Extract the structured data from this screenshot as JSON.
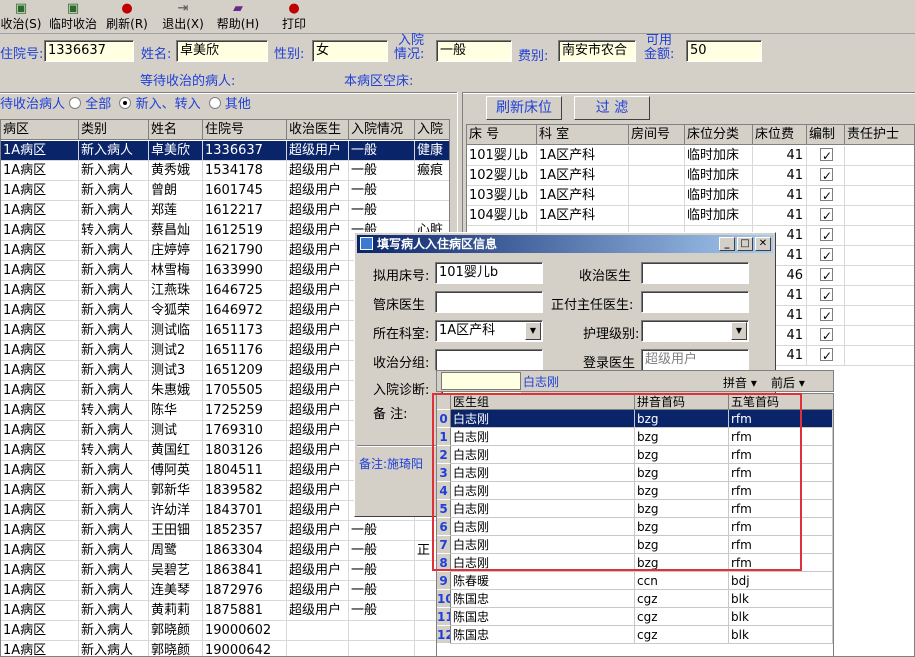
{
  "toolbar": {
    "items": [
      {
        "label": "收治(S)",
        "icon": "admit-icon"
      },
      {
        "label": "临时收治",
        "icon": "temp-admit-icon"
      },
      {
        "label": "刷新(R)",
        "icon": "refresh-icon"
      },
      {
        "label": "退出(X)",
        "icon": "exit-icon"
      },
      {
        "label": "帮助(H)",
        "icon": "help-book-icon"
      },
      {
        "label": "打印",
        "icon": "print-icon"
      }
    ]
  },
  "info": {
    "admission_no_label": "住院号:",
    "admission_no": "1336637",
    "name_label": "姓名:",
    "name": "卓美欣",
    "gender_label": "性别:",
    "gender": "女",
    "admit_status_label_1": "入院",
    "admit_status_label_2": "情况:",
    "admit_status": "一般",
    "fee_label": "费别:",
    "fee": "南安市农合",
    "available_label_1": "可用",
    "available_label_2": "金额:",
    "available": "50",
    "waiting_caption": "等待收治的病人:",
    "empty_beds_caption": "本病区空床:"
  },
  "filter": {
    "label": "待收治病人",
    "options": [
      "全部",
      "新入、转入",
      "其他"
    ],
    "selected": 1
  },
  "patients": {
    "columns": [
      "病区",
      "类别",
      "姓名",
      "住院号",
      "收治医生",
      "入院情况",
      "入院"
    ],
    "rows": [
      [
        "1A病区",
        "新入病人",
        "卓美欣",
        "1336637",
        "超级用户",
        "一般",
        "健康"
      ],
      [
        "1A病区",
        "新入病人",
        "黄秀娥",
        "1534178",
        "超级用户",
        "一般",
        "瘢痕"
      ],
      [
        "1A病区",
        "新入病人",
        "曾朗",
        "1601745",
        "超级用户",
        "一般",
        ""
      ],
      [
        "1A病区",
        "新入病人",
        "郑莲",
        "1612217",
        "超级用户",
        "一般",
        ""
      ],
      [
        "1A病区",
        "转入病人",
        "蔡昌灿",
        "1612519",
        "超级用户",
        "一般",
        "心脏"
      ],
      [
        "1A病区",
        "新入病人",
        "庄婷婷",
        "1621790",
        "超级用户",
        "",
        ""
      ],
      [
        "1A病区",
        "新入病人",
        "林雪梅",
        "1633990",
        "超级用户",
        "",
        ""
      ],
      [
        "1A病区",
        "新入病人",
        "江燕珠",
        "1646725",
        "超级用户",
        "",
        ""
      ],
      [
        "1A病区",
        "新入病人",
        "令狐荣",
        "1646972",
        "超级用户",
        "",
        ""
      ],
      [
        "1A病区",
        "新入病人",
        "测试临",
        "1651173",
        "超级用户",
        "",
        ""
      ],
      [
        "1A病区",
        "新入病人",
        "测试2",
        "1651176",
        "超级用户",
        "",
        ""
      ],
      [
        "1A病区",
        "新入病人",
        "测试3",
        "1651209",
        "超级用户",
        "",
        ""
      ],
      [
        "1A病区",
        "新入病人",
        "朱惠娥",
        "1705505",
        "超级用户",
        "",
        ""
      ],
      [
        "1A病区",
        "转入病人",
        "陈华",
        "1725259",
        "超级用户",
        "",
        ""
      ],
      [
        "1A病区",
        "新入病人",
        "测试",
        "1769310",
        "超级用户",
        "",
        ""
      ],
      [
        "1A病区",
        "转入病人",
        "黄国红",
        "1803126",
        "超级用户",
        "",
        ""
      ],
      [
        "1A病区",
        "新入病人",
        "傅阿英",
        "1804511",
        "超级用户",
        "",
        ""
      ],
      [
        "1A病区",
        "新入病人",
        "郭新华",
        "1839582",
        "超级用户",
        "",
        ""
      ],
      [
        "1A病区",
        "新入病人",
        "许幼洋",
        "1843701",
        "超级用户",
        "",
        ""
      ],
      [
        "1A病区",
        "新入病人",
        "王田钿",
        "1852357",
        "超级用户",
        "一般",
        ""
      ],
      [
        "1A病区",
        "新入病人",
        "周鹭",
        "1863304",
        "超级用户",
        "一般",
        "正"
      ],
      [
        "1A病区",
        "新入病人",
        "吴碧艺",
        "1863841",
        "超级用户",
        "一般",
        ""
      ],
      [
        "1A病区",
        "新入病人",
        "连美琴",
        "1872976",
        "超级用户",
        "一般",
        ""
      ],
      [
        "1A病区",
        "新入病人",
        "黄莉莉",
        "1875881",
        "超级用户",
        "一般",
        ""
      ],
      [
        "1A病区",
        "新入病人",
        "郭晓颜",
        "19000602",
        "",
        "",
        ""
      ],
      [
        "1A病区",
        "新入病人",
        "郭晓颜",
        "19000642",
        "",
        "",
        ""
      ]
    ]
  },
  "beds": {
    "refresh_label": "刷新床位",
    "filter_label": "过  滤",
    "columns": [
      "床  号",
      "科  室",
      "房间号",
      "床位分类",
      "床位费",
      "编制",
      "责任护士"
    ],
    "rows": [
      [
        "101婴儿b",
        "1A区产科",
        "",
        "临时加床",
        "41",
        true,
        ""
      ],
      [
        "102婴儿b",
        "1A区产科",
        "",
        "临时加床",
        "41",
        true,
        ""
      ],
      [
        "103婴儿b",
        "1A区产科",
        "",
        "临时加床",
        "41",
        true,
        ""
      ],
      [
        "104婴儿b",
        "1A区产科",
        "",
        "临时加床",
        "41",
        true,
        ""
      ],
      [
        "",
        "",
        "",
        "",
        "41",
        true,
        ""
      ],
      [
        "",
        "",
        "",
        "",
        "41",
        true,
        ""
      ],
      [
        "",
        "",
        "",
        "",
        "46",
        true,
        ""
      ],
      [
        "",
        "",
        "",
        "",
        "41",
        true,
        ""
      ],
      [
        "",
        "",
        "",
        "",
        "41",
        true,
        ""
      ],
      [
        "",
        "",
        "",
        "",
        "41",
        true,
        ""
      ],
      [
        "",
        "",
        "",
        "",
        "41",
        true,
        ""
      ]
    ]
  },
  "dialog": {
    "title": "填写病人入住病区信息",
    "bed_label": "拟用床号:",
    "bed": "101婴儿b",
    "admit_doctor_label": "收治医生",
    "admit_doctor": "",
    "bed_doctor_label": "管床医生",
    "bed_doctor": "",
    "chief_doctor_label": "正付主任医生:",
    "chief_doctor": "",
    "dept_label": "所在科室:",
    "dept": "1A区产科",
    "nursing_label": "护理级别:",
    "nursing": "",
    "group_label": "收治分组:",
    "group": "",
    "login_doctor_label": "登录医生",
    "login_doctor": "超级用户",
    "diagnosis_label": "入院诊断:",
    "diagnosis": "",
    "remark_label": "备    注:",
    "note_text": "备注:施琦阳"
  },
  "popup": {
    "search_text": "白志刚",
    "mode_pinyin": "拼音",
    "mode_match": "前后",
    "columns": [
      "医生组",
      "拼音首码",
      "五笔首码"
    ],
    "rows": [
      [
        "白志刚",
        "bzg",
        "rfm"
      ],
      [
        "白志刚",
        "bzg",
        "rfm"
      ],
      [
        "白志刚",
        "bzg",
        "rfm"
      ],
      [
        "白志刚",
        "bzg",
        "rfm"
      ],
      [
        "白志刚",
        "bzg",
        "rfm"
      ],
      [
        "白志刚",
        "bzg",
        "rfm"
      ],
      [
        "白志刚",
        "bzg",
        "rfm"
      ],
      [
        "白志刚",
        "bzg",
        "rfm"
      ],
      [
        "白志刚",
        "bzg",
        "rfm"
      ],
      [
        "陈春暖",
        "ccn",
        "bdj"
      ],
      [
        "陈国忠",
        "cgz",
        "blk"
      ],
      [
        "陈国忠",
        "cgz",
        "blk"
      ],
      [
        "陈国忠",
        "cgz",
        "blk"
      ]
    ],
    "selected": 0,
    "highlight_color": "#e0303a"
  }
}
